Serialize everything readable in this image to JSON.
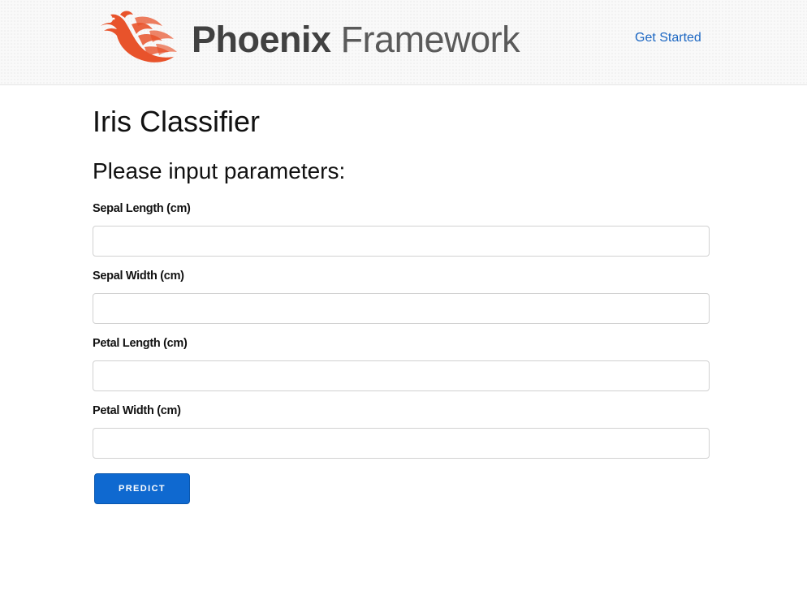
{
  "header": {
    "logo": {
      "name_bold": "Phoenix",
      "name_light": "Framework",
      "icon": "phoenix-bird-logo",
      "colors": {
        "bird": "#e8532b"
      }
    },
    "nav": {
      "get_started": "Get Started"
    }
  },
  "main": {
    "title": "Iris Classifier",
    "subtitle": "Please input parameters:",
    "fields": [
      {
        "label": "Sepal Length (cm)",
        "value": ""
      },
      {
        "label": "Sepal Width (cm)",
        "value": ""
      },
      {
        "label": "Petal Length (cm)",
        "value": ""
      },
      {
        "label": "Petal Width (cm)",
        "value": ""
      }
    ],
    "submit_label": "Predict"
  },
  "colors": {
    "link": "#1b66c2",
    "button": "#0f69d0",
    "input_border": "#d1d1d1"
  }
}
